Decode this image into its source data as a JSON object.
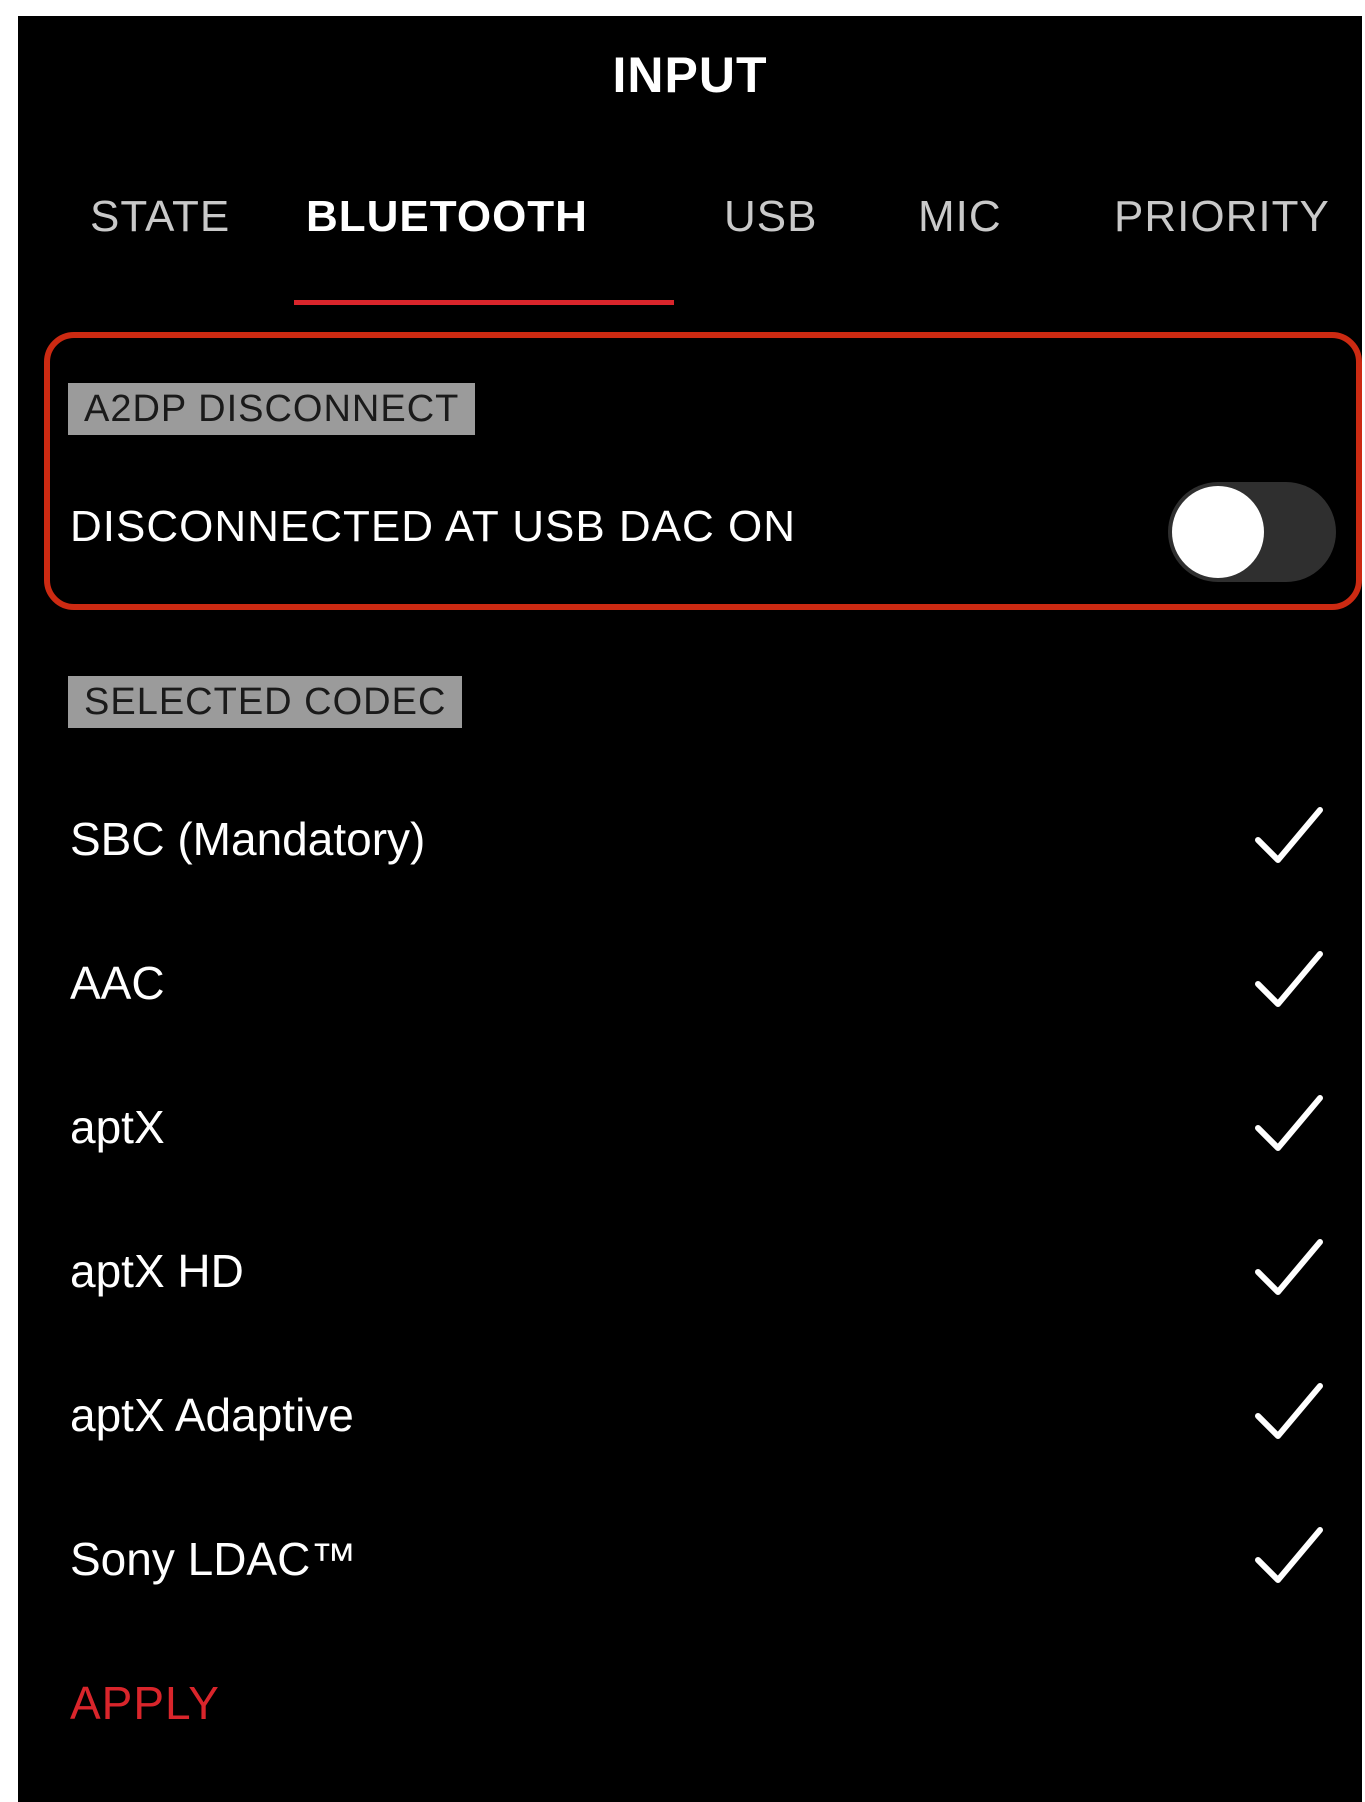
{
  "header": {
    "title": "INPUT"
  },
  "tabs": [
    {
      "label": "STATE"
    },
    {
      "label": "BLUETOOTH",
      "active": true
    },
    {
      "label": "USB"
    },
    {
      "label": "MIC"
    },
    {
      "label": "PRIORITY"
    }
  ],
  "a2dp": {
    "section_label": "A2DP DISCONNECT",
    "setting_label": "DISCONNECTED AT USB DAC ON",
    "toggle_on": false
  },
  "codec": {
    "section_label": "SELECTED CODEC",
    "items": [
      {
        "name": "SBC (Mandatory)",
        "checked": true
      },
      {
        "name": "AAC",
        "checked": true
      },
      {
        "name": "aptX",
        "checked": true
      },
      {
        "name": "aptX HD",
        "checked": true
      },
      {
        "name": "aptX Adaptive",
        "checked": true
      },
      {
        "name": "Sony LDAC™",
        "checked": true
      }
    ]
  },
  "actions": {
    "apply_label": "APPLY"
  },
  "colors": {
    "accent": "#d9252b",
    "highlight_border": "#cc2a12",
    "background": "#000000",
    "section_tag": "#9b9b9b"
  },
  "icons": {
    "check": "checkmark-icon"
  }
}
